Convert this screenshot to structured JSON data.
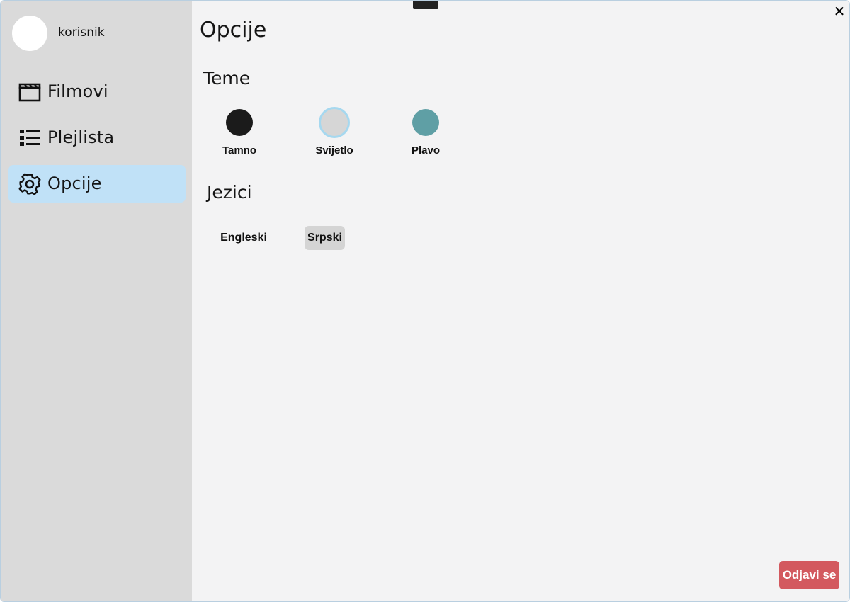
{
  "user": {
    "name": "korisnik"
  },
  "sidebar": {
    "items": [
      {
        "label": "Filmovi",
        "icon": "film-clapper-icon",
        "active": false
      },
      {
        "label": "Plejlista",
        "icon": "list-icon",
        "active": false
      },
      {
        "label": "Opcije",
        "icon": "gear-icon",
        "active": true
      }
    ]
  },
  "page": {
    "title": "Opcije"
  },
  "themes": {
    "title": "Teme",
    "options": [
      {
        "label": "Tamno",
        "color": "#1b1b1b",
        "selected": false
      },
      {
        "label": "Svijetlo",
        "color": "#d6d6d6",
        "selected": true
      },
      {
        "label": "Plavo",
        "color": "#5f9fa5",
        "selected": false
      }
    ]
  },
  "languages": {
    "title": "Jezici",
    "options": [
      {
        "label": "Engleski",
        "selected": false
      },
      {
        "label": "Srpski",
        "selected": true
      }
    ]
  },
  "actions": {
    "logout_label": "Odjavi se",
    "close_glyph": "✕"
  },
  "colors": {
    "sidebar": "#dadada",
    "content": "#f3f3f4",
    "active_nav": "#c0e1f7",
    "logout": "#d3595f",
    "selected_ring": "#a6d8ef"
  }
}
